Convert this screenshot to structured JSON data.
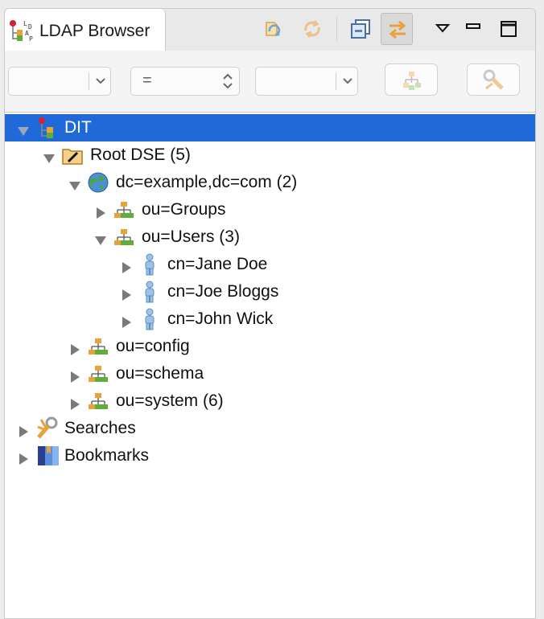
{
  "view": {
    "tab_title": "LDAP Browser",
    "tab_icon": "ldap-browser-icon"
  },
  "toolbar": {
    "buttons": [
      {
        "name": "refresh-root-button",
        "icon": "refresh-root-icon"
      },
      {
        "name": "reload-button",
        "icon": "reload-arrows-icon"
      },
      {
        "name": "collapse-all-button",
        "icon": "collapse-all-icon"
      },
      {
        "name": "link-with-editor-button",
        "icon": "link-arrows-icon",
        "pressed": true
      },
      {
        "name": "view-menu-button",
        "icon": "triangle-down-icon"
      },
      {
        "name": "minimize-button",
        "icon": "minimize-icon"
      },
      {
        "name": "maximize-button",
        "icon": "maximize-icon"
      }
    ]
  },
  "filter": {
    "attribute_value": "",
    "operator_value": "=",
    "value_value": "",
    "apply_icon": "quick-search-icon",
    "clear_icon": "clear-search-icon"
  },
  "colors": {
    "selection": "#1f6ad8",
    "accent_orange": "#e8a23a",
    "accent_green": "#5fae3a"
  },
  "tree": {
    "nodes": [
      {
        "label": "DIT",
        "depth": 0,
        "expanded": true,
        "selected": true,
        "icon": "dit-icon"
      },
      {
        "label": "Root DSE (5)",
        "depth": 1,
        "expanded": true,
        "icon": "root-dse-icon"
      },
      {
        "label": "dc=example,dc=com (2)",
        "depth": 2,
        "expanded": true,
        "icon": "globe-icon"
      },
      {
        "label": "ou=Groups",
        "depth": 3,
        "expanded": false,
        "icon": "org-unit-icon"
      },
      {
        "label": "ou=Users (3)",
        "depth": 3,
        "expanded": true,
        "icon": "org-unit-icon"
      },
      {
        "label": "cn=Jane Doe",
        "depth": 4,
        "expanded": false,
        "icon": "person-icon"
      },
      {
        "label": "cn=Joe Bloggs",
        "depth": 4,
        "expanded": false,
        "icon": "person-icon"
      },
      {
        "label": "cn=John Wick",
        "depth": 4,
        "expanded": false,
        "icon": "person-icon"
      },
      {
        "label": "ou=config",
        "depth": 2,
        "expanded": false,
        "icon": "org-unit-icon"
      },
      {
        "label": "ou=schema",
        "depth": 2,
        "expanded": false,
        "icon": "org-unit-icon"
      },
      {
        "label": "ou=system (6)",
        "depth": 2,
        "expanded": false,
        "icon": "org-unit-icon"
      },
      {
        "label": "Searches",
        "depth": 0,
        "expanded": false,
        "icon": "searches-icon"
      },
      {
        "label": "Bookmarks",
        "depth": 0,
        "expanded": false,
        "icon": "bookmarks-icon"
      }
    ]
  }
}
